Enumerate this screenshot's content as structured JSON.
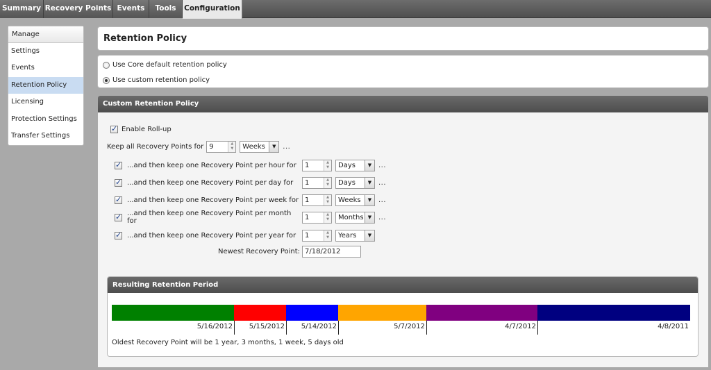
{
  "tabs": [
    {
      "label": "Summary"
    },
    {
      "label": "Recovery Points"
    },
    {
      "label": "Events"
    },
    {
      "label": "Tools"
    },
    {
      "label": "Configuration",
      "active": true
    }
  ],
  "sidebar": {
    "header": "Manage",
    "items": [
      {
        "label": "Settings"
      },
      {
        "label": "Events"
      },
      {
        "label": "Retention Policy",
        "active": true
      },
      {
        "label": "Licensing"
      },
      {
        "label": "Protection Settings"
      },
      {
        "label": "Transfer Settings"
      }
    ]
  },
  "page_title": "Retention Policy",
  "policy_options": [
    {
      "label": "Use Core default retention policy",
      "selected": false
    },
    {
      "label": "Use custom retention policy",
      "selected": true
    }
  ],
  "custom": {
    "header": "Custom Retention Policy",
    "enable_rollup": {
      "label": "Enable Roll-up",
      "checked": true
    },
    "keep_all": {
      "label": "Keep all Recovery Points for",
      "value": "9",
      "unit": "Weeks",
      "ellipsis": "..."
    },
    "rules": [
      {
        "label": "...and then keep one Recovery Point per hour for",
        "checked": true,
        "value": "1",
        "unit": "Days",
        "ellipsis": "..."
      },
      {
        "label": "...and then keep one Recovery Point per day for",
        "checked": true,
        "value": "1",
        "unit": "Days",
        "ellipsis": "..."
      },
      {
        "label": "...and then keep one Recovery Point per week for",
        "checked": true,
        "value": "1",
        "unit": "Weeks",
        "ellipsis": "..."
      },
      {
        "label": "...and then keep one Recovery Point per month for",
        "checked": true,
        "value": "1",
        "unit": "Months",
        "ellipsis": "..."
      },
      {
        "label": "...and then keep one Recovery Point per year for",
        "checked": true,
        "value": "1",
        "unit": "Years",
        "ellipsis": ""
      }
    ],
    "newest": {
      "label": "Newest Recovery Point:",
      "value": "7/18/2012"
    }
  },
  "result": {
    "header": "Resulting Retention Period",
    "segments": [
      {
        "color": "#008000",
        "end_label": "5/16/2012"
      },
      {
        "color": "#ff0000",
        "end_label": "5/15/2012"
      },
      {
        "color": "#0000ff",
        "end_label": "5/14/2012"
      },
      {
        "color": "#ffa500",
        "end_label": "5/7/2012"
      },
      {
        "color": "#800080",
        "end_label": "4/7/2012"
      },
      {
        "color": "#000080",
        "end_label": "4/8/2011"
      }
    ],
    "oldest_text": "Oldest Recovery Point will be 1 year, 3 months, 1 week, 5 days old"
  }
}
